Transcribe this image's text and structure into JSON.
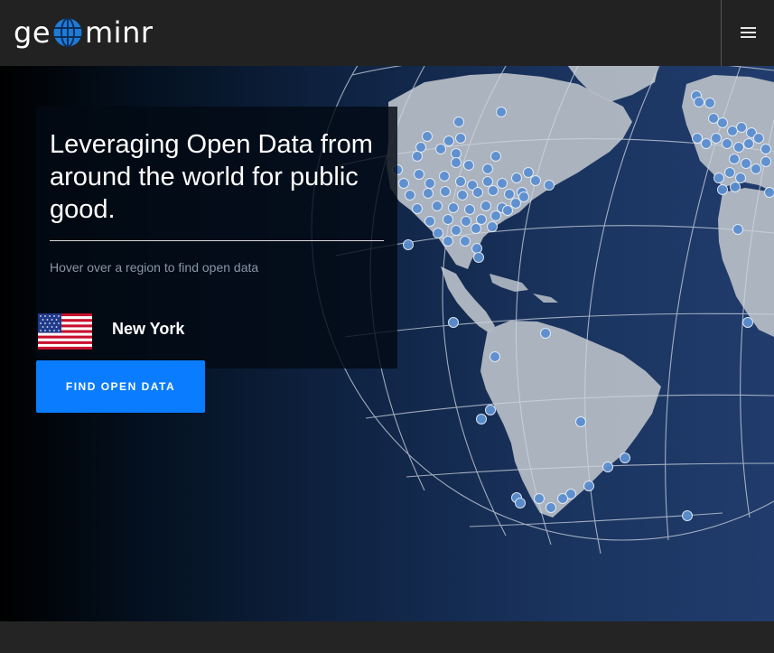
{
  "brand": {
    "logo_prefix": "ge",
    "logo_suffix": "minr",
    "accent": "#1e7bd8"
  },
  "nav": {
    "menu_icon": "hamburger-menu-icon"
  },
  "hero": {
    "headline": "Leveraging Open Data from around the world for public good.",
    "hint": "Hover over a region to find open data",
    "selected_region": {
      "flag": "united-states-flag-icon",
      "name": "New York"
    },
    "cta_label": "FIND OPEN DATA"
  },
  "colors": {
    "background": "#222222",
    "cta": "#0a7cff",
    "land": "#b3bac4",
    "grid": "#cfd6e0",
    "marker": "#5b8fd0"
  }
}
